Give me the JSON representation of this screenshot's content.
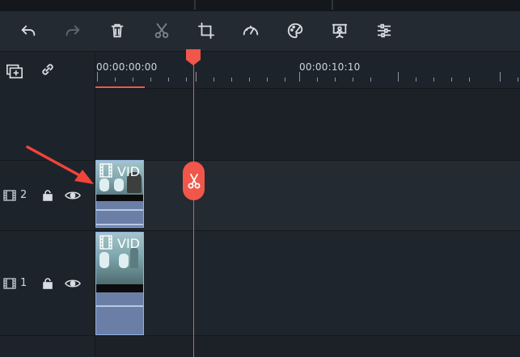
{
  "toolbar": {
    "icons": [
      "undo-icon",
      "redo-icon",
      "delete-icon",
      "cut-icon",
      "crop-icon",
      "speed-icon",
      "color-icon",
      "green-screen-icon",
      "adjust-icon"
    ]
  },
  "timeline": {
    "timecodes": [
      "00:00:00:00",
      "00:00:10:10"
    ],
    "tracks": [
      {
        "number": "2",
        "clip_label": "VID"
      },
      {
        "number": "1",
        "clip_label": "VID"
      }
    ]
  },
  "colors": {
    "playhead": "#f0564a",
    "clip_border": "#8fb0e6",
    "annotation_arrow": "#f0443a"
  }
}
